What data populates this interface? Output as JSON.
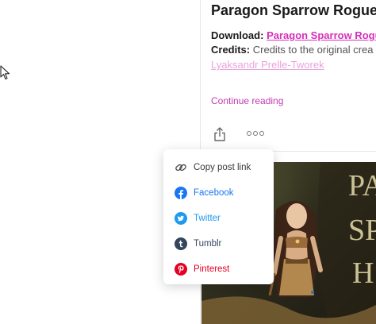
{
  "post": {
    "title": "Paragon Sparrow Rogue",
    "download_label": "Download:",
    "download_link": "Paragon Sparrow Rogue",
    "credits_label": "Credits:",
    "credits_text": "Credits to the original crea",
    "author": "Lyaksandr Prelle-Tworek",
    "continue": "Continue reading"
  },
  "actions": {
    "share_icon": "share-icon",
    "more_icon": "more-horizontal-icon"
  },
  "share_menu": {
    "items": [
      {
        "label": "Copy post link",
        "icon": "link-icon",
        "color": "#3a3a3a"
      },
      {
        "label": "Facebook",
        "icon": "facebook-icon",
        "color": "#1877f2"
      },
      {
        "label": "Twitter",
        "icon": "twitter-icon",
        "color": "#1d9bf0"
      },
      {
        "label": "Tumblr",
        "icon": "tumblr-icon",
        "color": "#35465c"
      },
      {
        "label": "Pinterest",
        "icon": "pinterest-icon",
        "color": "#e60023"
      }
    ]
  },
  "hero": {
    "title_fragment": "PA\nSP\nH"
  },
  "colors": {
    "accent": "#d62fb9",
    "title": "#1a1a1a"
  }
}
